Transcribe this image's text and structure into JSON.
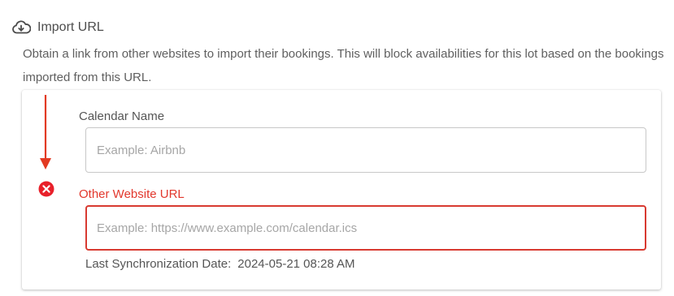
{
  "section": {
    "icon": "cloud-download-icon",
    "title": "Import URL",
    "description": "Obtain a link from other websites to import their bookings. This will block availabilities for this lot based on the bookings imported from this URL."
  },
  "form": {
    "calendar_name": {
      "label": "Calendar Name",
      "value": "",
      "placeholder": "Example: Airbnb"
    },
    "website_url": {
      "label": "Other Website URL",
      "value": "",
      "placeholder": "Example: https://www.example.com/calendar.ics",
      "state": "error"
    },
    "sync": {
      "label": "Last Synchronization Date:",
      "value": "2024-05-21 08:28 AM"
    }
  },
  "colors": {
    "error": "#e2382d",
    "arrow": "#e23a22"
  },
  "icons": {
    "arrow": "arrow-down-icon",
    "error": "error-circle-icon"
  }
}
